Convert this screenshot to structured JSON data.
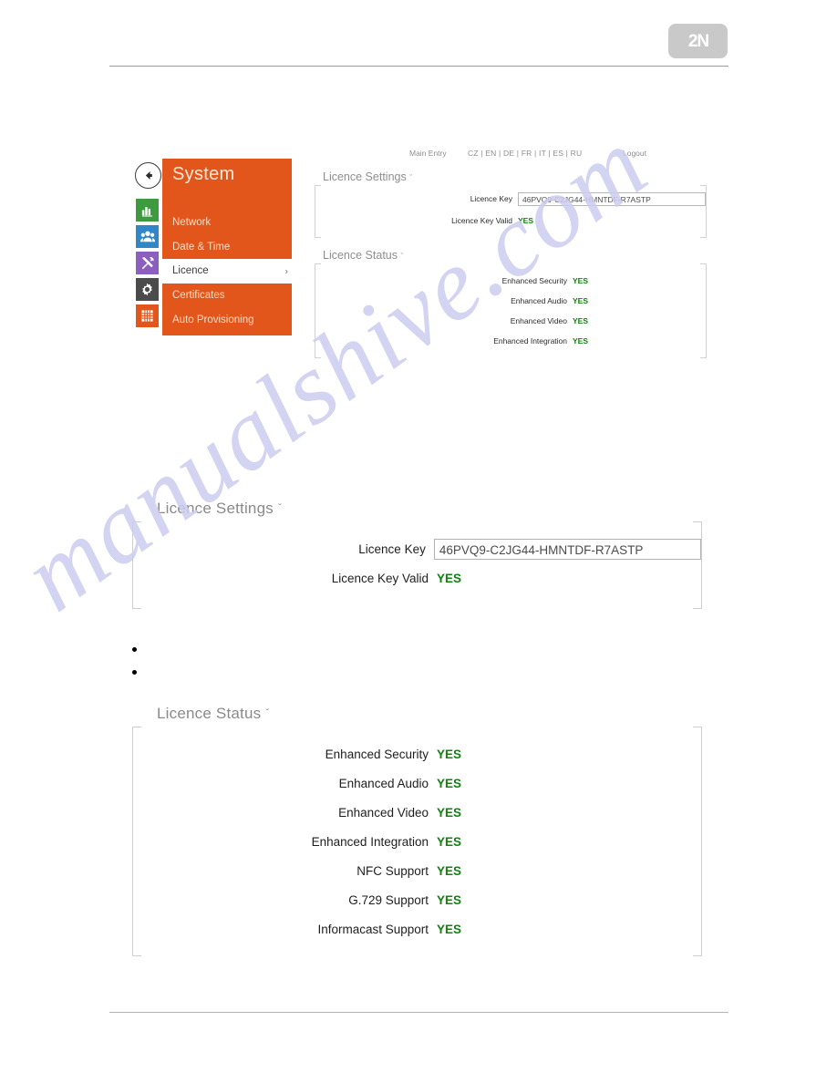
{
  "logo": {
    "text": "2N",
    "color": "#c9c9c9"
  },
  "colors": {
    "orange": "#e2561b",
    "green": "#128012",
    "label_gray": "#8a8a8a",
    "watermark": "#ccccf0"
  },
  "watermark": {
    "text": "manualshive.com"
  },
  "screenshot": {
    "topbar": {
      "main_entry": "Main Entry",
      "languages": "CZ | EN | DE | FR | IT | ES | RU",
      "logout": "Logout"
    },
    "sidebar": {
      "title": "System",
      "back_icon": "back-arrow-icon",
      "rail_icons": [
        {
          "name": "statistics-icon",
          "color": "#3e9a3e"
        },
        {
          "name": "users-icon",
          "color": "#2f87c8"
        },
        {
          "name": "tools-icon",
          "color": "#8b5fbf"
        },
        {
          "name": "gear-icon",
          "color": "#4b4b4b"
        },
        {
          "name": "grid-icon",
          "color": "#e2561b"
        }
      ],
      "items": [
        {
          "label": "Network",
          "active": false
        },
        {
          "label": "Date & Time",
          "active": false
        },
        {
          "label": "Licence",
          "active": true,
          "chevron": "›"
        },
        {
          "label": "Certificates",
          "active": false
        },
        {
          "label": "Auto Provisioning",
          "active": false
        }
      ]
    },
    "licence_settings": {
      "title": "Licence Settings",
      "caret": "ˇ",
      "key_label": "Licence Key",
      "key_value": "46PVQ9-C2JG44-HMNTDF-R7ASTP",
      "valid_label": "Licence Key Valid",
      "valid_value": "YES"
    },
    "licence_status": {
      "title": "Licence Status",
      "caret": "ˇ",
      "rows": [
        {
          "label": "Enhanced Security",
          "value": "YES"
        },
        {
          "label": "Enhanced Audio",
          "value": "YES"
        },
        {
          "label": "Enhanced Video",
          "value": "YES"
        },
        {
          "label": "Enhanced Integration",
          "value": "YES"
        }
      ]
    }
  },
  "figure_settings": {
    "title": "Licence Settings",
    "caret": "ˇ",
    "key_label": "Licence Key",
    "key_value": "46PVQ9-C2JG44-HMNTDF-R7ASTP",
    "valid_label": "Licence Key Valid",
    "valid_value": "YES"
  },
  "bullets": [
    "",
    ""
  ],
  "figure_status": {
    "title": "Licence Status",
    "caret": "ˇ",
    "rows": [
      {
        "label": "Enhanced Security",
        "value": "YES"
      },
      {
        "label": "Enhanced Audio",
        "value": "YES"
      },
      {
        "label": "Enhanced Video",
        "value": "YES"
      },
      {
        "label": "Enhanced Integration",
        "value": "YES"
      },
      {
        "label": "NFC Support",
        "value": "YES"
      },
      {
        "label": "G.729 Support",
        "value": "YES"
      },
      {
        "label": "Informacast Support",
        "value": "YES"
      }
    ]
  }
}
